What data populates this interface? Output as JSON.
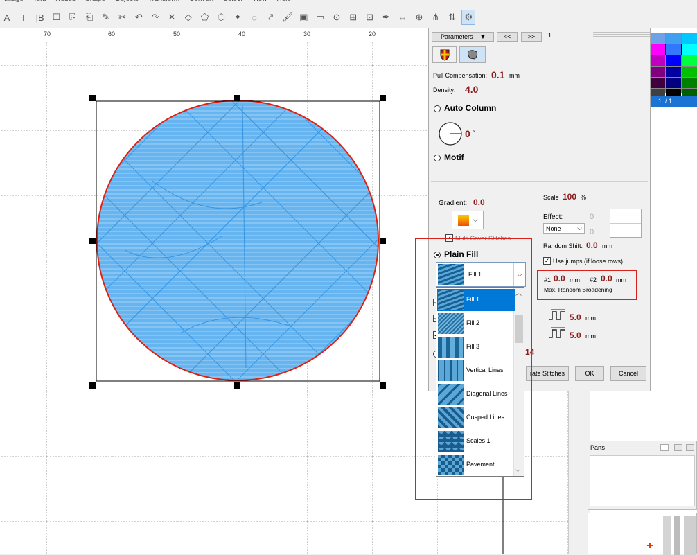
{
  "menu": [
    "Image",
    "Text",
    "Nodes",
    "Shape",
    "Objects",
    "Transform",
    "Convert",
    "Select",
    "View",
    "Help"
  ],
  "toolbar": {
    "icons": [
      "a-icon",
      "text-icon",
      "tb-icon",
      "page-icon",
      "copy-icon",
      "paste-icon",
      "edit-icon",
      "cut-icon",
      "undo-icon",
      "redo-icon",
      "close-icon",
      "node-icon",
      "shape-icon",
      "group-icon",
      "wand-icon",
      "lasso-icon",
      "eyedropper-icon",
      "brush-icon",
      "fill-icon",
      "frame-icon",
      "capture-icon",
      "emboss-icon",
      "applique-icon",
      "pen-icon",
      "align-icon",
      "center-icon",
      "distribute-icon",
      "flip-icon",
      "settings-icon"
    ],
    "selected_index": 28
  },
  "ruler": {
    "labels": [
      "70",
      "60",
      "50",
      "40",
      "30",
      "20"
    ]
  },
  "dialog": {
    "tab_label": "Parameters",
    "nav_prev": "<<",
    "nav_next": ">>",
    "page_num": "1",
    "pull_comp_label": "Pull Compensation:",
    "pull_comp_value": "0.1",
    "pull_comp_unit": "mm",
    "density_label": "Density:",
    "density_value": "4.0",
    "auto_column_label": "Auto Column",
    "angle_value": "0",
    "angle_unit": "°",
    "motif_label": "Motif",
    "gradient_label": "Gradient:",
    "gradient_value": "0.0",
    "scale_label": "Scale",
    "scale_value": "100",
    "scale_unit": "%",
    "effect_label": "Effect:",
    "effect_value": "None",
    "effect_num1": "0",
    "effect_num2": "0",
    "random_shift_label": "Random Shift:",
    "random_shift_value": "0.0",
    "random_shift_unit": "mm",
    "multi_cover_label": "Multi Cover Stitches",
    "use_jumps_label": "Use jumps (if loose rows)",
    "broadening_1_prefix": "#1",
    "broadening_1_value": "0.0",
    "broadening_1_unit": "mm",
    "broadening_2_prefix": "#2",
    "broadening_2_value": "0.0",
    "broadening_2_unit": "mm",
    "broadening_label": "Max. Random Broadening",
    "stitch_len_1": "5.0",
    "stitch_len_1_unit": "mm",
    "stitch_len_2": "5.0",
    "stitch_len_2_unit": "mm",
    "plain_fill_label": "Plain Fill",
    "selected_fill": "Fill 1",
    "partial_value": "14",
    "generate_btn": "rate Stitches",
    "ok_btn": "OK",
    "cancel_btn": "Cancel"
  },
  "fill_options": [
    {
      "label": "Fill 1",
      "pattern": "wave",
      "selected": true
    },
    {
      "label": "Fill 2",
      "pattern": "diag-fine",
      "selected": false
    },
    {
      "label": "Fill 3",
      "pattern": "vbands",
      "selected": false
    },
    {
      "label": "Vertical Lines",
      "pattern": "vlines",
      "selected": false
    },
    {
      "label": "Diagonal Lines",
      "pattern": "dlines",
      "selected": false
    },
    {
      "label": "Cusped Lines",
      "pattern": "chevron",
      "selected": false
    },
    {
      "label": "Scales 1",
      "pattern": "scales",
      "selected": false
    },
    {
      "label": "Pavement",
      "pattern": "diamond",
      "selected": false
    }
  ],
  "palette": [
    "#6fa0e8",
    "#3fa0f0",
    "#00c8ff",
    "#ff00ff",
    "#3377ff",
    "#00ffff",
    "#c000c0",
    "#0000ff",
    "#00ff40",
    "#800080",
    "#0000a0",
    "#00c000",
    "#400040",
    "#000080",
    "#008000",
    "#404040",
    "#000000",
    "#006000"
  ],
  "layer_bar": "1. / 1",
  "parts_label": "Parts",
  "colors": {
    "accent_red": "#d6211d",
    "value_red": "#8b1a1a",
    "selection_blue": "#0078d7",
    "stitch_blue": "#4aa8ee",
    "outline_red": "#e02010"
  }
}
